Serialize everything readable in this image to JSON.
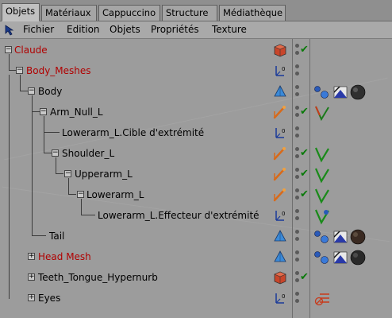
{
  "tabs": [
    {
      "label": "Objets",
      "active": true
    },
    {
      "label": "Matériaux"
    },
    {
      "label": "Cappuccino"
    },
    {
      "label": "Structure"
    },
    {
      "label": "Médiathèque"
    }
  ],
  "menu": {
    "icon": "pointer-icon",
    "items": [
      "Fichier",
      "Edition",
      "Objets",
      "Propriétés",
      "Texture"
    ]
  },
  "colors": {
    "tab_active": "#c0c0c0",
    "panel_bg": "#9c9c9c",
    "red_label": "#b00000",
    "check_green": "#0a7a0a"
  },
  "tree": [
    {
      "label": "Claude",
      "red": true,
      "icon": "cube-red-icon",
      "check": true,
      "tags": []
    },
    {
      "label": "Body_Meshes",
      "red": true,
      "icon": "null-axis-icon",
      "check": false,
      "tags": []
    },
    {
      "label": "Body",
      "red": false,
      "icon": "polygon-mesh-icon",
      "check": false,
      "tags": [
        "phong-tag-icon",
        "texture-tag-icon",
        "material-sphere-icon"
      ]
    },
    {
      "label": "Arm_Null_L",
      "red": false,
      "icon": "bone-icon",
      "check": true,
      "tags": [
        "ik-tag-icon"
      ]
    },
    {
      "label": "Lowerarm_L.Cible d'extrémité",
      "red": false,
      "icon": "null-axis-icon",
      "check": false,
      "tags": []
    },
    {
      "label": "Shoulder_L",
      "red": false,
      "icon": "bone-icon",
      "check": true,
      "tags": [
        "ik-tag-icon"
      ]
    },
    {
      "label": "Upperarm_L",
      "red": false,
      "icon": "bone-icon",
      "check": true,
      "tags": [
        "ik-tag-icon"
      ]
    },
    {
      "label": "Lowerarm_L",
      "red": false,
      "icon": "bone-icon",
      "check": true,
      "tags": [
        "ik-tag-icon"
      ]
    },
    {
      "label": "Lowerarm_L.Effecteur d'extrémité",
      "red": false,
      "icon": "null-axis-icon",
      "check": false,
      "tags": [
        "ik-effector-tag-icon"
      ]
    },
    {
      "label": "Tail",
      "red": false,
      "icon": "polygon-mesh-icon",
      "check": false,
      "tags": [
        "phong-tag-icon",
        "texture-tag-icon",
        "material-sphere-icon"
      ]
    },
    {
      "label": "Head Mesh",
      "red": true,
      "icon": "polygon-mesh-icon",
      "check": false,
      "tags": [
        "phong-tag-icon",
        "texture-tag-icon",
        "material-sphere-icon"
      ]
    },
    {
      "label": "Teeth_Tongue_Hypernurb",
      "red": false,
      "icon": "cube-red-icon",
      "check": true,
      "tags": []
    },
    {
      "label": "Eyes",
      "red": false,
      "icon": "null-axis-icon",
      "check": false,
      "tags": [
        "display-tag-icon"
      ]
    }
  ]
}
